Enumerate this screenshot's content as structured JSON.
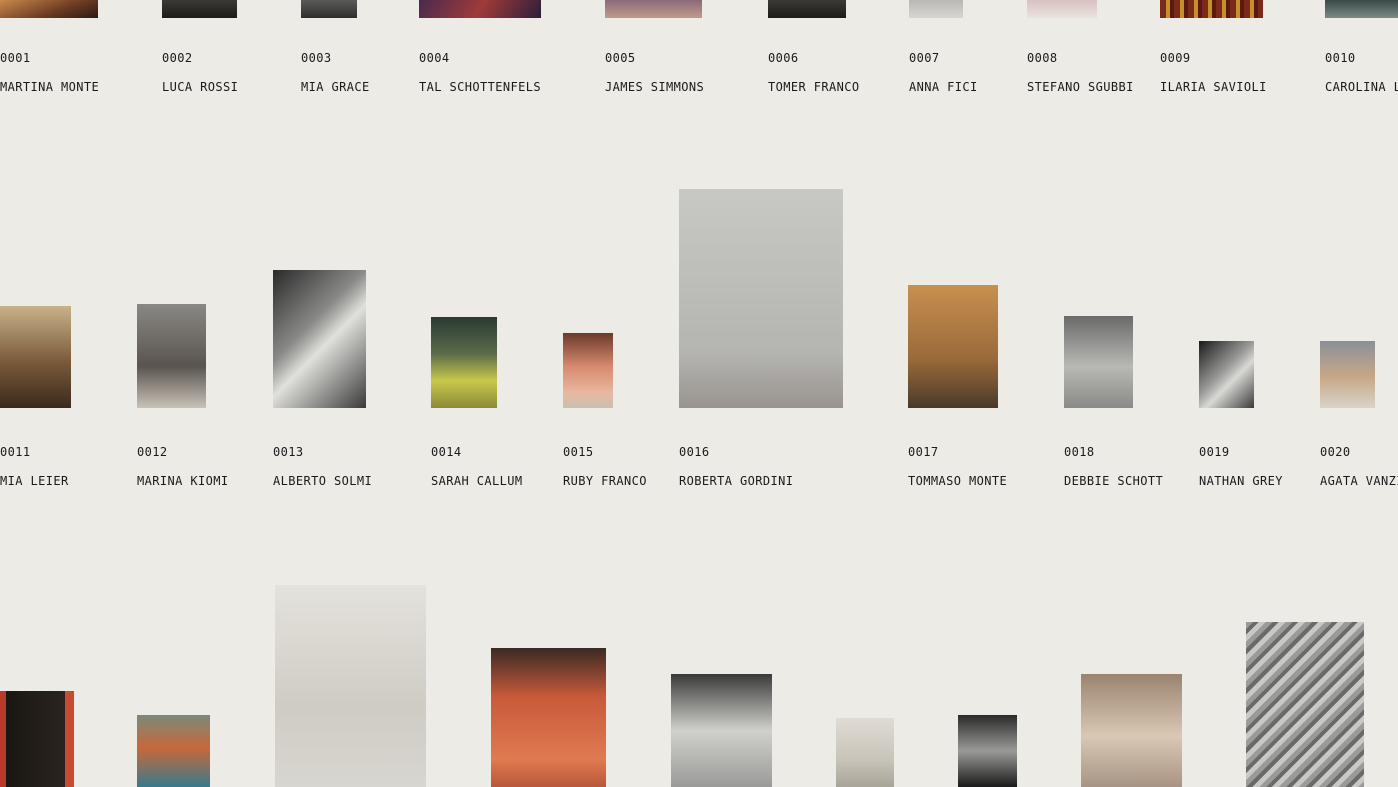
{
  "gallery": {
    "row1": [
      {
        "num": "0001",
        "name": "MARTINA MONTE",
        "icon": "photo-restaurant"
      },
      {
        "num": "0002",
        "name": "LUCA ROSSI",
        "icon": "photo-dark-street"
      },
      {
        "num": "0003",
        "name": "MIA GRACE",
        "icon": "photo-portrait"
      },
      {
        "num": "0004",
        "name": "TAL SCHOTTENFELS",
        "icon": "photo-interior"
      },
      {
        "num": "0005",
        "name": "JAMES SIMMONS",
        "icon": "photo-couple"
      },
      {
        "num": "0006",
        "name": "TOMER FRANCO",
        "icon": "photo-shadow"
      },
      {
        "num": "0007",
        "name": "ANNA FICI",
        "icon": "photo-pavement"
      },
      {
        "num": "0008",
        "name": "STEFANO SGUBBI",
        "icon": "photo-street"
      },
      {
        "num": "0009",
        "name": "ILARIA SAVIOLI",
        "icon": "photo-theater"
      },
      {
        "num": "0010",
        "name": "CAROLINA L",
        "icon": "photo-street"
      }
    ],
    "row2": [
      {
        "num": "0011",
        "name": "MIA LEIER",
        "icon": "photo-cafe-counter"
      },
      {
        "num": "0012",
        "name": "MARINA KIOMI",
        "icon": "photo-couple-street"
      },
      {
        "num": "0013",
        "name": "ALBERTO SOLMI",
        "icon": "photo-hands-writing"
      },
      {
        "num": "0014",
        "name": "SARAH CALLUM",
        "icon": "photo-man-reading"
      },
      {
        "num": "0015",
        "name": "RUBY FRANCO",
        "icon": "photo-storefront"
      },
      {
        "num": "0016",
        "name": "ROBERTA GORDINI",
        "icon": "photo-woman-child"
      },
      {
        "num": "0017",
        "name": "TOMMASO MONTE",
        "icon": "photo-bench-seniors"
      },
      {
        "num": "0018",
        "name": "DEBBIE SCHOTT",
        "icon": "photo-street-kids"
      },
      {
        "num": "0019",
        "name": "NATHAN GREY",
        "icon": "photo-sitting-bw"
      },
      {
        "num": "0020",
        "name": "AGATA VANZI",
        "icon": "photo-terrace"
      }
    ],
    "row3": [
      {
        "icon": "photo-cinema"
      },
      {
        "icon": "photo-market"
      },
      {
        "icon": "photo-woman-bike"
      },
      {
        "icon": "photo-legs-floor"
      },
      {
        "icon": "photo-lace-skirt"
      },
      {
        "icon": "photo-man-bike"
      },
      {
        "icon": "photo-bw-road"
      },
      {
        "icon": "photo-two-ladies"
      },
      {
        "icon": "photo-crowd-bw"
      }
    ]
  },
  "colors": {
    "background": "#ecebe6",
    "text": "#1a1a1a"
  }
}
